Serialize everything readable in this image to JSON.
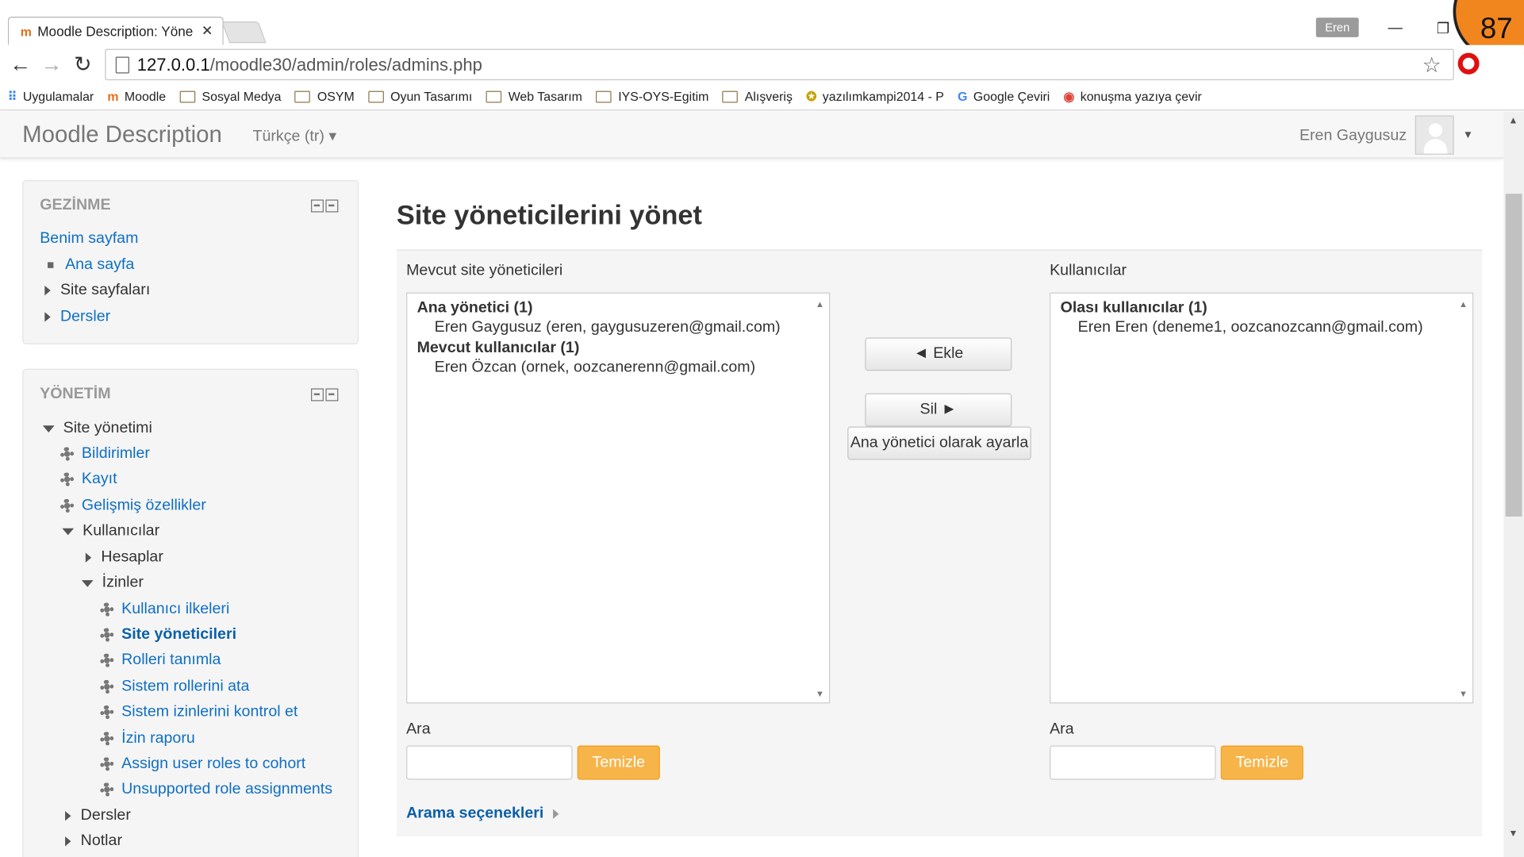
{
  "browser": {
    "tab_title": "Moodle Description: Yöne",
    "tab_close": "✕",
    "profile_name": "Eren",
    "overlay_number": "87",
    "url_host": "127.0.0.1",
    "url_path": "/moodle30/admin/roles/admins.php",
    "bookmarks": [
      {
        "label": "Uygulamalar",
        "icon": "apps-grid-icon"
      },
      {
        "label": "Moodle",
        "icon": "moodle-icon"
      },
      {
        "label": "Sosyal Medya",
        "icon": "folder-icon"
      },
      {
        "label": "OSYM",
        "icon": "folder-icon"
      },
      {
        "label": "Oyun Tasarımı",
        "icon": "folder-icon"
      },
      {
        "label": "Web Tasarım",
        "icon": "folder-icon"
      },
      {
        "label": "IYS-OYS-Egitim",
        "icon": "folder-icon"
      },
      {
        "label": "Alışveriş",
        "icon": "folder-icon"
      },
      {
        "label": "yazılımkampi2014 - P",
        "icon": "cat-icon"
      },
      {
        "label": "Google Çeviri",
        "icon": "translate-icon"
      },
      {
        "label": "konuşma yazıya çevir",
        "icon": "chrome-icon"
      }
    ]
  },
  "header": {
    "site_name": "Moodle Description",
    "language": "Türkçe (tr) ▾",
    "user_name": "Eren Gaygusuz",
    "menu_caret": "▼"
  },
  "navigation": {
    "title": "GEZİNME",
    "my_page": "Benim sayfam",
    "home": "Ana sayfa",
    "site_pages": "Site sayfaları",
    "courses": "Dersler"
  },
  "administration": {
    "title": "YÖNETİM",
    "site_admin": "Site yönetimi",
    "notifications": "Bildirimler",
    "registration": "Kayıt",
    "advanced_features": "Gelişmiş özellikler",
    "users": "Kullanıcılar",
    "accounts": "Hesaplar",
    "permissions": "İzinler",
    "user_policies": "Kullanıcı ilkeleri",
    "site_admins": "Site yöneticileri",
    "define_roles": "Rolleri tanımla",
    "assign_system_roles": "Sistem rollerini ata",
    "check_system_permissions": "Sistem izinlerini kontrol et",
    "permission_report": "İzin raporu",
    "assign_cohort_roles": "Assign user roles to cohort",
    "unsupported_role_assignments": "Unsupported role assignments",
    "courses": "Dersler",
    "grades": "Notlar"
  },
  "main": {
    "title": "Site yöneticilerini yönet",
    "existing_label": "Mevcut site yöneticileri",
    "existing_groups": [
      {
        "title": "Ana yönetici (1)",
        "items": [
          "Eren Gaygusuz (eren, gaygusuzeren@gmail.com)"
        ]
      },
      {
        "title": "Mevcut kullanıcılar (1)",
        "items": [
          "Eren Özcan (ornek, oozcanerenn@gmail.com)"
        ]
      }
    ],
    "users_label": "Kullanıcılar",
    "potential_group": {
      "title": "Olası kullanıcılar (1)",
      "items": [
        "Eren Eren (deneme1, oozcanozcann@gmail.com)"
      ]
    },
    "add_button": "◄ Ekle",
    "remove_button": "Sil ►",
    "set_main_admin_button": "Ana yönetici olarak ayarla",
    "search_label_left": "Ara",
    "search_label_right": "Ara",
    "clear_button": "Temizle",
    "search_options": "Arama seçenekleri"
  }
}
